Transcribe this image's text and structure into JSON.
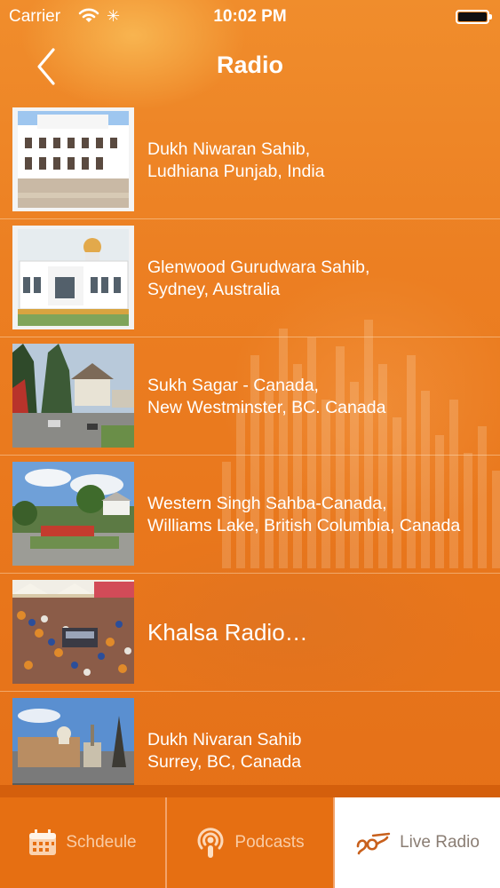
{
  "status_bar": {
    "carrier": "Carrier",
    "time": "10:02 PM"
  },
  "nav": {
    "title": "Radio",
    "back_icon": "chevron-left-icon"
  },
  "stations": [
    {
      "name": "Dukh Niwaran Sahib,\nLudhiana Punjab, India",
      "thumb": "white-gurdwara-building"
    },
    {
      "name": "Glenwood Gurudwara Sahib,\nSydney, Australia",
      "thumb": "white-domed-gurdwara"
    },
    {
      "name": "Sukh Sagar - Canada,\nNew Westminster, BC. Canada",
      "thumb": "street-with-trees"
    },
    {
      "name": "Western Singh Sahba-Canada,\nWilliams Lake, British Columbia, Canada",
      "thumb": "gurdwara-with-lawn"
    },
    {
      "name": "Khalsa Radio…",
      "thumb": "crowd-procession"
    },
    {
      "name": "Dukh Nivaran Sahib\nSurrey, BC, Canada",
      "thumb": "domed-building-blue-sky"
    }
  ],
  "tabs": [
    {
      "label": "Schdeule",
      "icon": "calendar-icon",
      "active": false
    },
    {
      "label": "Podcasts",
      "icon": "podcast-icon",
      "active": false
    },
    {
      "label": "Live Radio",
      "icon": "ik-onkar-icon",
      "active": true
    }
  ],
  "colors": {
    "accent": "#ec7f22",
    "tab_bar": "#e66f12",
    "active_tab_bg": "#ffffff"
  }
}
